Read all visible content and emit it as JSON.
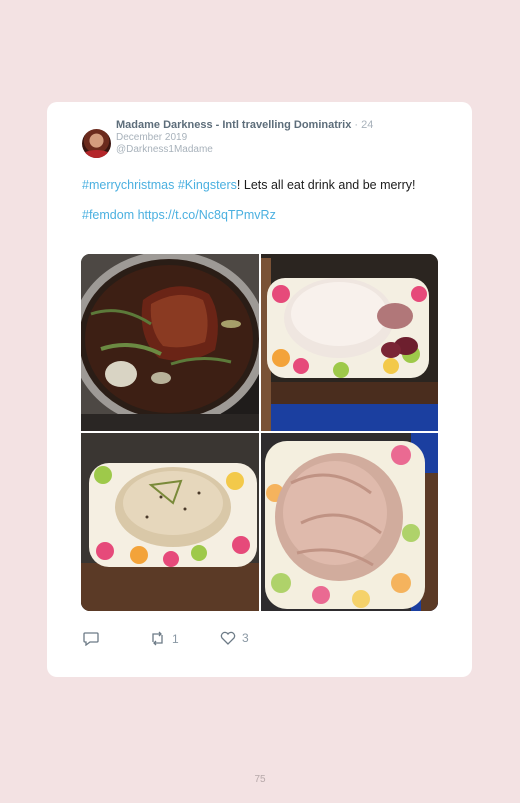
{
  "tweet": {
    "author_name": "Madame Darkness - Intl travelling Dominatrix",
    "date_prefix": " · 24",
    "date_rest": "December 2019",
    "handle": "@Darkness1Madame",
    "text": {
      "hashtag1": "#merrychristmas",
      "hashtag2": "#Kingsters",
      "line1_rest": "! Lets all eat drink and be merry!",
      "hashtag3": "#femdom",
      "link": "https://t.co/Nc8qTPmvRz"
    },
    "media_icons": [
      "photo-pot-with-ham",
      "photo-raw-duck-on-tray",
      "photo-seasoned-duck",
      "photo-ham-in-wrap"
    ],
    "actions": {
      "reply_count": "",
      "retweet_count": "1",
      "like_count": "3"
    }
  },
  "page": {
    "number": "75"
  },
  "colors": {
    "background": "#f3e2e3",
    "link": "#4bb0e0",
    "muted": "#a8b2bb",
    "name": "#5d6d7a"
  }
}
